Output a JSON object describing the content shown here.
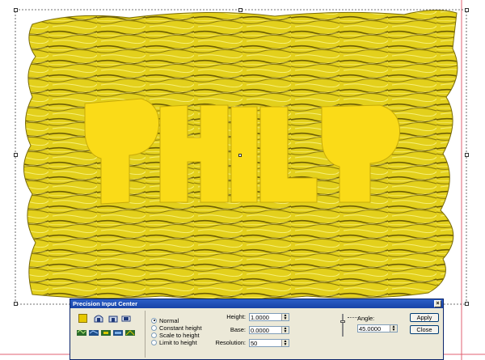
{
  "canvas": {
    "colors": {
      "relief": "#e6d41a",
      "relief_dark": "#8a7a08",
      "letters": "#fadb18",
      "frame_line": "#e06070",
      "selection": "#444444"
    },
    "icons": [
      "handle-icon",
      "center-handle-icon"
    ]
  },
  "dialog": {
    "title": "Precision Input Center",
    "close_icon": "×",
    "modes": [
      {
        "label": "Normal",
        "selected": true
      },
      {
        "label": "Constant height",
        "selected": false
      },
      {
        "label": "Scale to height",
        "selected": false
      },
      {
        "label": "Limit to height",
        "selected": false
      }
    ],
    "fields": {
      "height": {
        "label": "Height:",
        "value": "1.0000"
      },
      "base": {
        "label": "Base:",
        "value": "0.0000"
      },
      "resolution": {
        "label": "Resolution:",
        "value": "50"
      },
      "angle": {
        "label": "Angle:",
        "value": "45.0000"
      }
    },
    "buttons": {
      "apply": "Apply",
      "close": "Close"
    },
    "tool_icons": [
      "color-swatch-icon",
      "dome-icon",
      "arch-icon",
      "flat-icon",
      "emboss-tool-1-icon",
      "emboss-tool-2-icon",
      "emboss-tool-3-icon",
      "emboss-tool-4-icon",
      "emboss-tool-5-icon"
    ],
    "accent": "#0a246a"
  }
}
